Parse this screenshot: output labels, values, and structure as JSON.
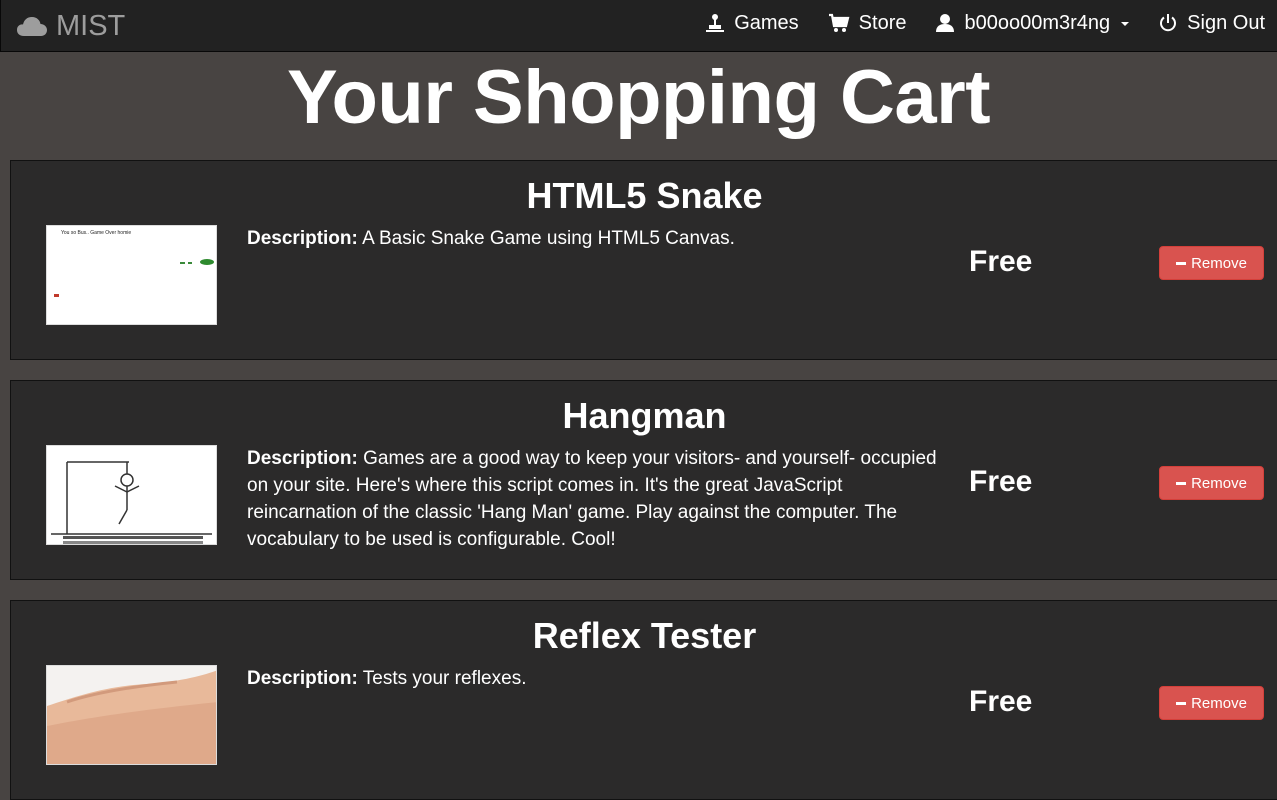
{
  "nav": {
    "brand": "MIST",
    "games_label": "Games",
    "store_label": "Store",
    "username": "b00oo00m3r4ng",
    "signout_label": "Sign Out"
  },
  "page": {
    "title": "Your Shopping Cart"
  },
  "cart": {
    "description_label": "Description:",
    "remove_label": "Remove",
    "items": [
      {
        "title": "HTML5 Snake",
        "description": "A Basic Snake Game using HTML5 Canvas.",
        "price": "Free",
        "thumbnail_caption": "You so Bus.. Game Over homie"
      },
      {
        "title": "Hangman",
        "description": "Games are a good way to keep your visitors- and yourself- occupied on your site. Here's where this script comes in. It's the great JavaScript reincarnation of the classic 'Hang Man' game. Play against the computer. The vocabulary to be used is configurable. Cool!",
        "price": "Free"
      },
      {
        "title": "Reflex Tester",
        "description": "Tests your reflexes.",
        "price": "Free"
      }
    ]
  },
  "colors": {
    "navbar": "#222222",
    "background": "#484442",
    "panel": "#2b2a2a",
    "danger": "#d9534f"
  },
  "icons": {
    "brand": "cloud-icon",
    "games": "joystick-icon",
    "store": "shopping-cart-icon",
    "user": "user-icon",
    "signout": "power-icon",
    "remove": "minus-icon"
  }
}
